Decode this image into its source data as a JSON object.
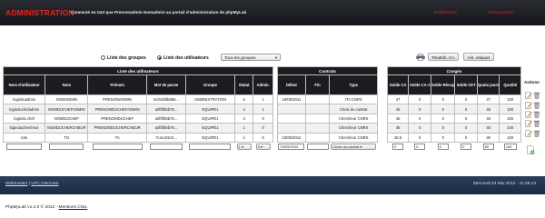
{
  "header": {
    "brand": "ADMINISTRATION",
    "subtitle": "Connecté en tant que Prenomadmin Nomadmin au portail d'administration de phpMyLab",
    "link_prefs": "Préférences",
    "link_logout": "Déconnexion"
  },
  "controls": {
    "radio_groups": "Liste des groupes",
    "radio_users": "Liste des utilisateurs",
    "groups_select": "Tous les groupes",
    "btn_reset_ca": "Réattrib. CA",
    "btn_init": "Init. reliquat"
  },
  "users_table": {
    "group_title": "Liste des utilisateurs",
    "headers": [
      "Nom d'utilisateur",
      "Nom",
      "Prénom",
      "Mot de passe",
      "Groupe",
      "Statut",
      "Admin."
    ],
    "rows": [
      [
        "loginduadmin",
        "NOMADMIN",
        "PRENOMADMIN",
        "5c043fdb856...",
        "ADMINISTRATION",
        "5",
        "1"
      ],
      [
        "loginduchefadmin",
        "NOMDUCHEFADMIN",
        "PRENOMDUCHEFADMIN",
        "a0f0fb5b78...",
        "EQUIPE1",
        "4",
        "1"
      ],
      [
        "logindu chef",
        "NOMDUCHEF",
        "PRENOMDUCHEF",
        "a0f0fb5b78...",
        "EQUIPE1",
        "3",
        "0"
      ],
      [
        "loginduchercheur",
        "NOMDUCHERCHEUR",
        "PRENOMDUCHERCHEUR",
        "a0f0fb5b78...",
        "EQUIPE1",
        "1",
        "0"
      ],
      [
        "toto",
        "TO",
        "TA",
        "7c4cc02c2...",
        "EQUIPE1",
        "1",
        "0"
      ]
    ],
    "filter_statut": "1",
    "filter_admin": "0"
  },
  "contracts_table": {
    "group_title": "Contrats",
    "headers": [
      "Début",
      "Fin",
      "Type"
    ],
    "rows": [
      [
        "19/05/2011",
        "",
        "ITA CNRS"
      ],
      [
        "",
        "",
        "Choix du contrat"
      ],
      [
        "",
        "",
        "Chercheur CNRS"
      ],
      [
        "",
        "",
        "Chercheur CNRS"
      ],
      [
        "23/05/2012",
        "",
        "Chercheur CNRS"
      ]
    ],
    "filter_debut": "23/05/2012",
    "filter_type": "Choix du contrat"
  },
  "leave_table": {
    "group_title": "Congés",
    "headers": [
      "Solde CA",
      "Solde CA-1",
      "Solde Récup",
      "Solde CET",
      "Quota jours",
      "Quotité"
    ],
    "rows": [
      [
        "47",
        "0",
        "0",
        "0",
        "47",
        "100"
      ],
      [
        "45",
        "0",
        "0",
        "0",
        "45",
        "100"
      ],
      [
        "45",
        "0",
        "0",
        "0",
        "45",
        "100"
      ],
      [
        "45",
        "0",
        "0",
        "0",
        "45",
        "100"
      ],
      [
        "30.5",
        "0",
        "0",
        "0",
        "30",
        "100"
      ]
    ],
    "filters": [
      "0",
      "0",
      "0",
      "0",
      "50",
      "100"
    ]
  },
  "actions": {
    "title": "Actions",
    "row_icons": [
      "edit-icon",
      "trash-icon"
    ],
    "add_icon": "add-user-icon"
  },
  "footer": {
    "link_webmestre": "Webmestre",
    "separator": " | ",
    "link_lab": "LPC Clermont",
    "date": "Mercredi 23 Mai 2012 - 11:25:13",
    "copyright": "PhpMyLab v1.2.0 © 2012 - ",
    "link_mentions": "Mentions CNIL"
  },
  "colors": {
    "brand_red": "#e2261d",
    "header_bg": "#1b1c20",
    "footer_bg": "#22324e"
  }
}
